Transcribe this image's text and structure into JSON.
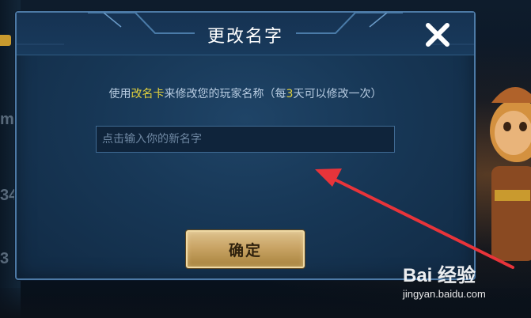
{
  "dialog": {
    "title": "更改名字",
    "instruction": {
      "prefix": "使用",
      "card": "改名卡",
      "middle": "来修改您的玩家名称（每",
      "days": "3",
      "suffix": "天可以修改一次）"
    },
    "name_input": {
      "value": "",
      "placeholder": "点击输入你的新名字"
    },
    "confirm_label": "确定",
    "close_icon": "close-x-icon"
  },
  "background": {
    "left_texts": [
      "m",
      "34",
      "3"
    ]
  },
  "watermark": {
    "logo": "Bai 经验",
    "url": "jingyan.baidu.com"
  },
  "colors": {
    "highlight": "#e3d23c",
    "confirm_button": "#c9a465",
    "dialog_border": "#4d7aa6",
    "annotation_arrow": "#e8343a"
  }
}
